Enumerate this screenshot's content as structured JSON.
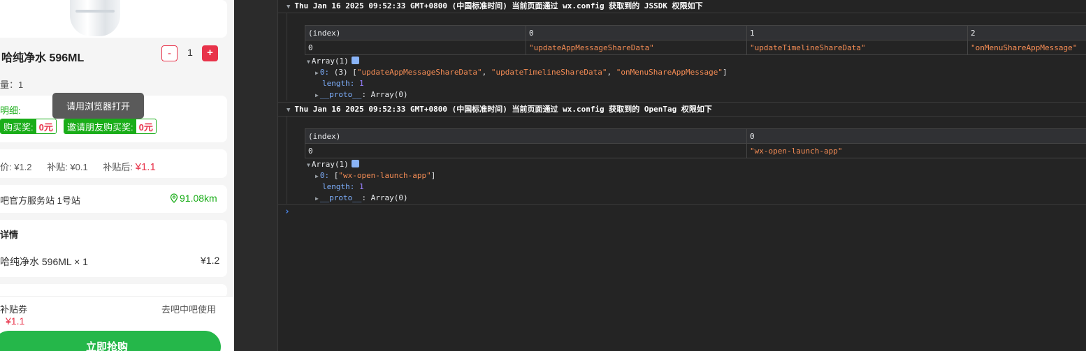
{
  "phone": {
    "product_name": "哈纯净水 596ML",
    "minus_label": "-",
    "plus_label": "+",
    "quantity": "1",
    "quantity_line": "量：1",
    "subsidy_detail_label": "明细:",
    "reward_1_label": "购买奖:",
    "reward_1_amount": "0元",
    "reward_2_label": "邀请朋友购买奖:",
    "reward_2_amount": "0元",
    "tooltip": "请用浏览器打开",
    "pricing_text": "价: ¥1.2      补贴: ¥0.1      补贴后: ",
    "pricing_after": "¥1.1",
    "station": "吧官方服务站 1号站",
    "distance": "91.08km",
    "detail_title": "详情",
    "item_name": "哈纯净水 596ML × 1",
    "item_price": "¥1.2",
    "coupon_label": "补贴券",
    "coupon_price": "¥1.1",
    "use_link": "去吧中吧使用",
    "buy_button": "立即抢购"
  },
  "console": {
    "log1": {
      "header": "Thu Jan 16 2025 09:52:33 GMT+0800 (中国标准时间) 当前页面通过 wx.config 获取到的 JSSDK 权限如下",
      "table_headers": [
        "(index)",
        "0",
        "1",
        "2"
      ],
      "table_row": [
        "0",
        "\"updateAppMessageShareData\"",
        "\"updateTimelineShareData\"",
        "\"onMenuShareAppMessage\""
      ],
      "array_label": "Array(1)",
      "item0_key": "0:",
      "item0_prefix": "(3) [",
      "item0_v1": "\"updateAppMessageShareData\"",
      "item0_v2": "\"updateTimelineShareData\"",
      "item0_v3": "\"onMenuShareAppMessage\"",
      "item0_suffix": "]",
      "length_key": "length:",
      "length_val": "1",
      "proto_key": "__proto__",
      "proto_val": ": Array(0)"
    },
    "log2": {
      "header": "Thu Jan 16 2025 09:52:33 GMT+0800 (中国标准时间) 当前页面通过 wx.config 获取到的 OpenTag 权限如下",
      "table_headers": [
        "(index)",
        "0"
      ],
      "table_row": [
        "0",
        "\"wx-open-launch-app\""
      ],
      "array_label": "Array(1)",
      "item0_key": "0:",
      "item0_prefix": "[",
      "item0_v1": "\"wx-open-launch-app\"",
      "item0_suffix": "]",
      "length_key": "length:",
      "length_val": "1",
      "proto_key": "__proto__",
      "proto_val": ": Array(0)"
    },
    "prompt": "›"
  }
}
